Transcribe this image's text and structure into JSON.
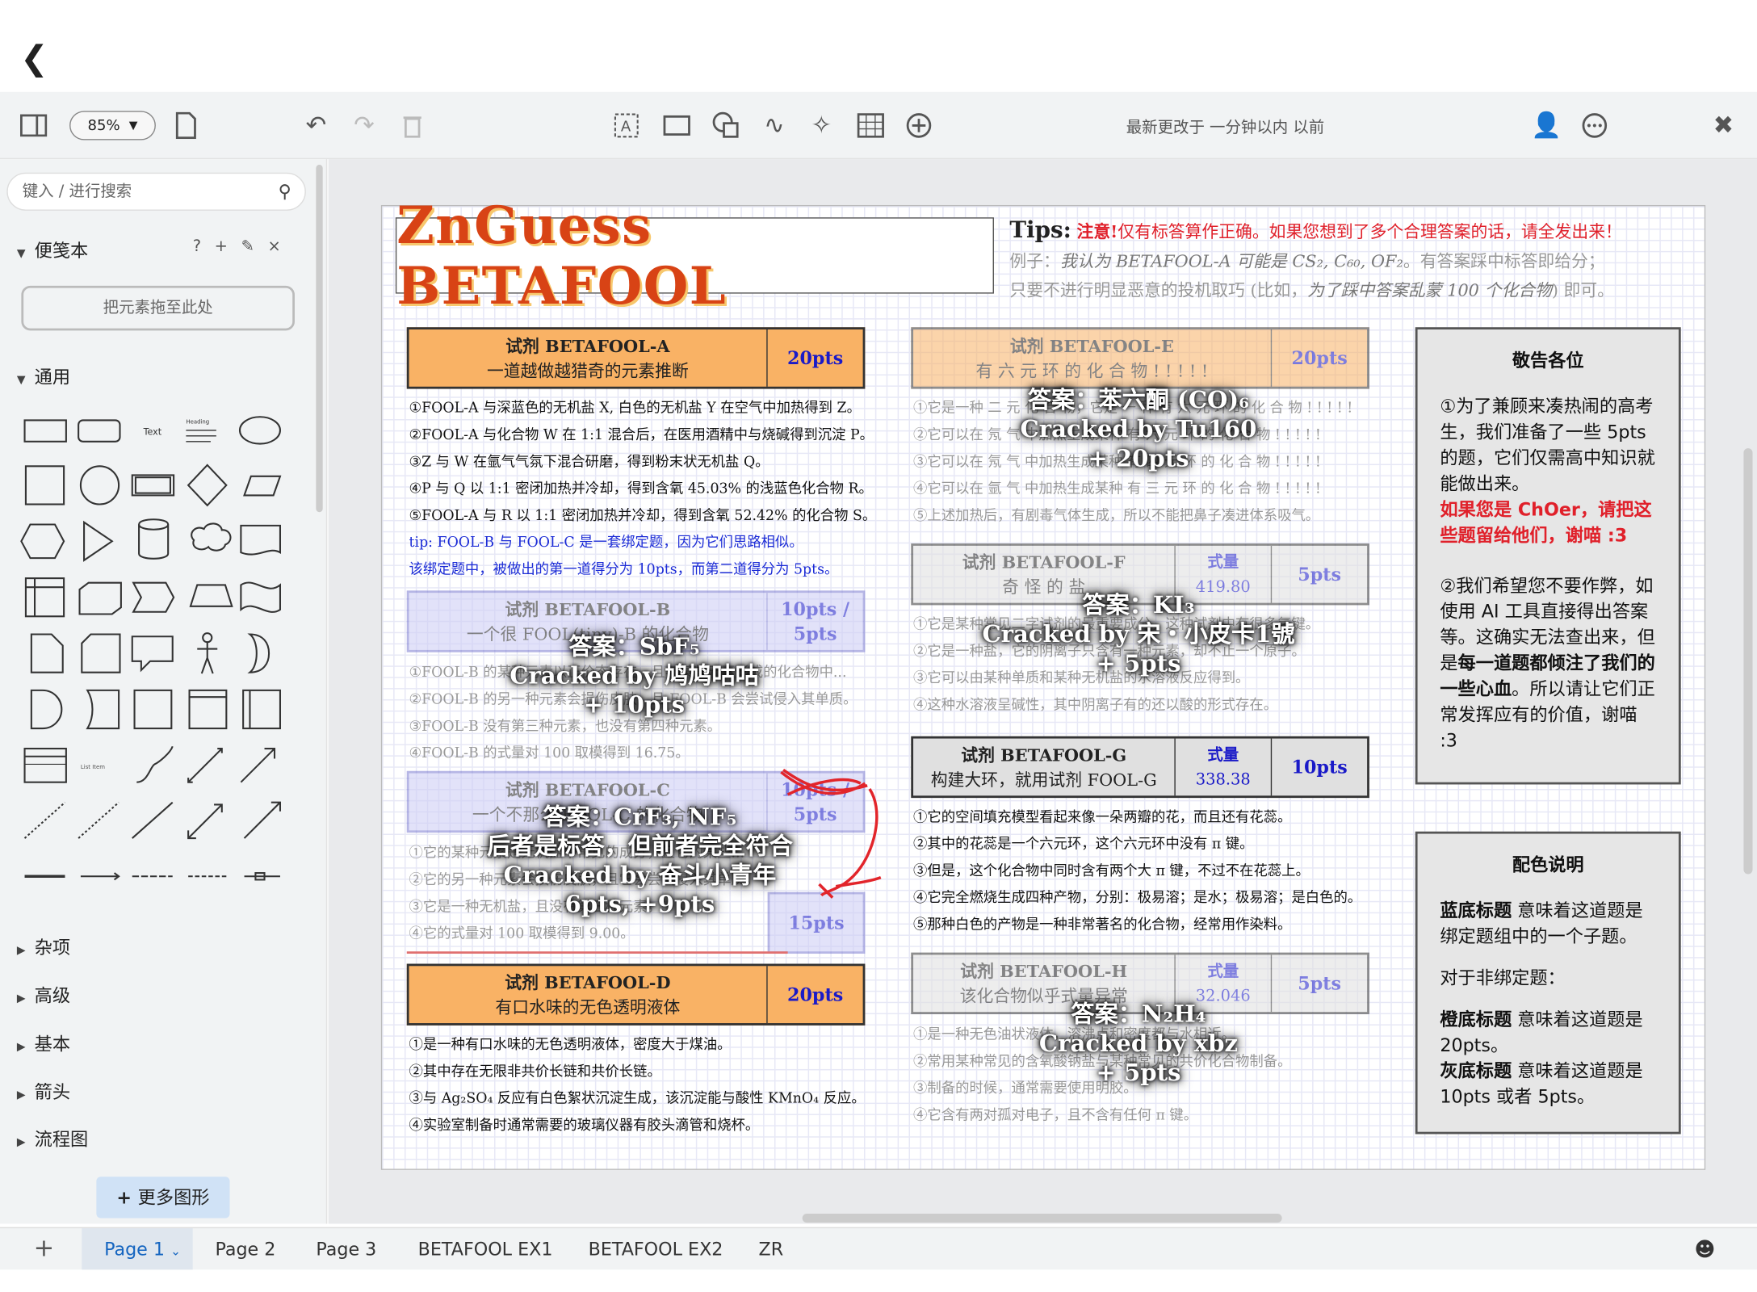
{
  "toolbar": {
    "zoom": "85%",
    "last_modified": "最新更改于 一分钟以内 以前"
  },
  "sidebar": {
    "search_placeholder": "键入 / 进行搜索",
    "notebook": "便笺本",
    "drop_hint": "把元素拖至此处",
    "general": "通用",
    "shape_text": "Text",
    "shape_heading": "Heading",
    "shape_list_item": "List Item",
    "sections": [
      "杂项",
      "高级",
      "基本",
      "箭头",
      "流程图"
    ],
    "more_shapes": "更多图形"
  },
  "tabs": [
    "Page 1",
    "Page 2",
    "Page 3",
    "BETAFOOL EX1",
    "BETAFOOL EX2",
    "ZR"
  ],
  "paper": {
    "title": "ZnGuess BETAFOOL",
    "tips": {
      "label": "Tips:",
      "warn": "注意!",
      "warn_text": "仅有标答算作正确。如果您想到了多个合理答案的话，请全发出来！",
      "line2a": "例子：",
      "line2b": "我认为 BETAFOOL-A 可能是 CS₂, C₆₀, OF₂",
      "line2c": "。有答案踩中标答即给分；",
      "line3a": "只要不进行明显恶意的投机取巧 (比如，",
      "line3b": "为了踩中答案乱蒙 100 个化合物",
      "line3c": ") 即可。"
    },
    "A": {
      "title": "试剂 BETAFOOL-A",
      "sub": "一道越做越猎奇的元素推断",
      "pts": "20pts",
      "lines": [
        "①FOOL-A 与深蓝色的无机盐 X, 白色的无机盐 Y 在空气中加热得到 Z。",
        "②FOOL-A 与化合物 W 在 1:1 混合后，在医用酒精中与烧碱得到沉淀 P。",
        "③Z 与 W 在氩气气氛下混合研磨，得到粉末状无机盐 Q。",
        "④P 与 Q 以 1:1 密闭加热并冷却，得到含氧 45.03% 的浅蓝色化合物 R。",
        "⑤FOOL-A 与 R 以 1:1 密闭加热并冷却，得到含氧 52.42% 的化合物 S。"
      ],
      "tip1": "tip: FOOL-B 与 FOOL-C 是一套绑定题，因为它们思路相似。",
      "tip2": "该绑定题中，被做出的第一道得分为 10pts，而第二道得分为 5pts。"
    },
    "B": {
      "title": "试剂 BETAFOOL-B",
      "sub": "一个很 FOOL(tiny)-B 的化合物",
      "pts1": "10pts /",
      "pts2": "5pts",
      "lines": [
        "①FOOL-B 的某种元素以正价态存在，且与某些元素形成的化合物中...",
        "②FOOL-B 的另一种元素会损伤皮肤，且 FOOL-B 会尝试侵入其单质。",
        "③FOOL-B 没有第三种元素，也没有第四种元素。",
        "④FOOL-B 的式量对 100 取模得到 16.75。"
      ],
      "answer": [
        "答案：SbF₅",
        "Cracked by 鸠鸠咕咕",
        "+ 10pts"
      ]
    },
    "C": {
      "title": "试剂 BETAFOOL-C",
      "sub": "一个不那么 FOOL-C 的化合物",
      "pts1": "10pts /",
      "pts2": "5pts",
      "pts3": "15pts",
      "lines": [
        "①它的某种元素是无机盐中常见的成分，且它的某些...",
        "②它的另一种元素会损伤皮肤，且它会尝试侵入其单质。",
        "③它是一种无机盐，且没有第三种元素。",
        "④它的式量对 100 取模得到 9.00。"
      ],
      "answer": [
        "答案：CrF₃, NF₅",
        "后者是标答，但前者完全符合",
        "Cracked by 奋斗小青年",
        "6pts, +9pts"
      ]
    },
    "D": {
      "title": "试剂 BETAFOOL-D",
      "sub": "有口水味的无色透明液体",
      "pts": "20pts",
      "lines": [
        "①是一种有口水味的无色透明液体，密度大于煤油。",
        "②其中存在无限非共价长链和共价长链。",
        "③与 Ag₂SO₄ 反应有白色絮状沉淀生成，该沉淀能与酸性 KMnO₄ 反应。",
        "④实验室制备时通常需要的玻璃仪器有胶头滴管和烧杯。"
      ]
    },
    "E": {
      "title": "试剂 BETAFOOL-E",
      "sub": "有 六 元 环 的 化 合 物 ! ! ! ! !",
      "pts": "20pts",
      "lines": [
        "①它是一种 二 元 化 合 物，它是 一 种 有 六 元 环 的 化 合 物 ! ! ! ! !",
        "②它可以在 氖 气 中加热生成某种 有 六 元 环 的 化 合 物 ! ! ! ! !",
        "③它可以在 氖 气 中加热生成某种 有 四 元 环 的 化 合 物 ! ! ! ! !",
        "④它可以在 氩 气 中加热生成某种 有 三 元 环 的 化 合 物 ! ! ! ! !",
        "⑤上述加热后，有剧毒气体生成，所以不能把鼻子凑进体系吸气。"
      ],
      "answer": [
        "答案：苯六酮 (CO)₆",
        "Cracked by Tu160",
        "+ 20pts"
      ]
    },
    "F": {
      "title": "试剂 BETAFOOL-F",
      "sub": "奇 怪 的 盐",
      "formula_label": "式量",
      "formula": "419.80",
      "pts": "5pts",
      "lines": [
        "①它是某种常见二字试剂的最重要成分，这种试剂中有很多氢键。",
        "②它是一种盐，它的阴离子只含有一种元素，却不止一个原子。",
        "③它可以由某种单质和某种无机盐的水溶液反应得到。",
        "④这种水溶液呈碱性，其中阴离子有的还以酸的形式存在。"
      ],
      "answer": [
        "答案：KI₃",
        "Cracked by 宋・小皮卡1號",
        "+ 5pts"
      ]
    },
    "G": {
      "title": "试剂 BETAFOOL-G",
      "sub": "构建大环，就用试剂 FOOL-G",
      "formula_label": "式量",
      "formula": "338.38",
      "pts": "10pts",
      "lines": [
        "①它的空间填充模型看起来像一朵两瓣的花，而且还有花蕊。",
        "②其中的花蕊是一个六元环，这个六元环中没有 π 键。",
        "③但是，这个化合物中同时含有两个大 π 键，不过不在花蕊上。",
        "④它完全燃烧生成四种产物，分别：极易溶；是水；极易溶；是白色的。",
        "⑤那种白色的产物是一种非常著名的化合物，经常用作染料。"
      ]
    },
    "H": {
      "title": "试剂 BETAFOOL-H",
      "sub": "该化合物似乎式量异常",
      "formula_label": "式量",
      "formula": "32.046",
      "pts": "5pts",
      "lines": [
        "①是一种无色油状液体，溶沸点和密度都与水相近。",
        "②常用某种常见的含氧酸钠盐与某种常见的共价化合物制备。",
        "③制备的时候，通常需要使用明胶。",
        "④它含有两对孤对电子，且不含有任何 π 键。"
      ],
      "answer": [
        "答案：N₂H₄",
        "Cracked by xbz",
        "+ 5pts"
      ]
    },
    "notice": {
      "title": "敬告各位",
      "p1": "①为了兼顾来凑热闹的高考生，我们准备了一些 5pts 的题，它们仅需高中知识就能做出来。",
      "p1red": "如果您是 ChOer，请把这些题留给他们，谢喵 :3",
      "p2a": "②我们希望您不要作弊，如使用 AI 工具直接得出答案等。这确实无法查出来，但是",
      "p2b": "每一道题都倾注了我们的一些心血",
      "p2c": "。所以请让它们正常发挥应有的价值，谢喵 :3"
    },
    "colors": {
      "title": "配色说明",
      "l1a": "蓝底标题",
      "l1b": " 意味着这道题是绑定题组中的一个子题。",
      "l2": "对于非绑定题：",
      "l3a": "橙底标题",
      "l3b": " 意味着这道题是 20pts。",
      "l4a": "灰底标题",
      "l4b": " 意味着这道题是 10pts 或者 5pts。"
    }
  },
  "colors": {
    "orange": "#f9b265",
    "blue": "#ccccf5",
    "gray": "#e0e0e0",
    "accent": "#1a1ac8",
    "warn": "#e0202a"
  }
}
